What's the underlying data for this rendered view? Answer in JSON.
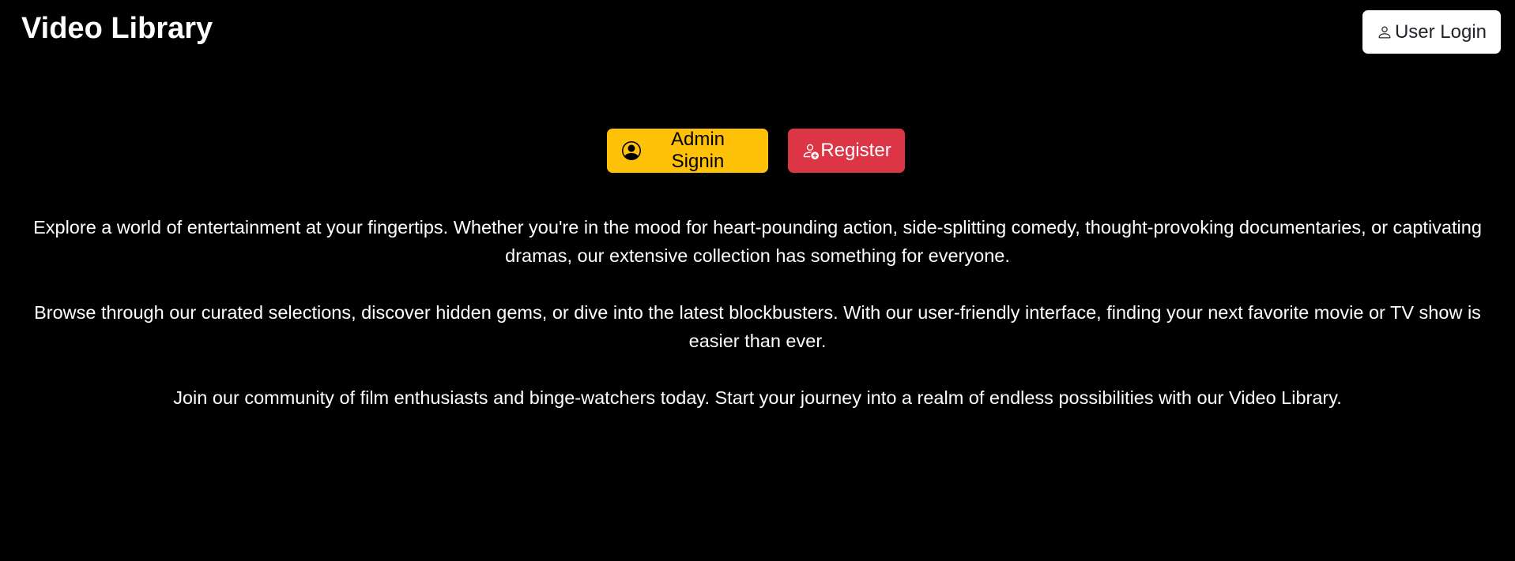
{
  "header": {
    "title": "Video Library",
    "login_label": "User Login",
    "login_icon": "person-icon"
  },
  "actions": {
    "admin_label": "Admin Signin",
    "admin_icon": "person-circle-icon",
    "admin_color": "#ffc107",
    "register_label": "Register",
    "register_icon": "person-add-icon",
    "register_color": "#dc3545"
  },
  "content": {
    "paragraphs": [
      "Explore a world of entertainment at your fingertips. Whether you're in the mood for heart-pounding action, side-splitting comedy, thought-provoking documentaries, or captivating dramas, our extensive collection has something for everyone.",
      "Browse through our curated selections, discover hidden gems, or dive into the latest blockbusters. With our user-friendly interface, finding your next favorite movie or TV show is easier than ever.",
      "Join our community of film enthusiasts and binge-watchers today. Start your journey into a realm of endless possibilities with our Video Library."
    ]
  },
  "colors": {
    "background": "#000000",
    "text": "#ffffff"
  }
}
